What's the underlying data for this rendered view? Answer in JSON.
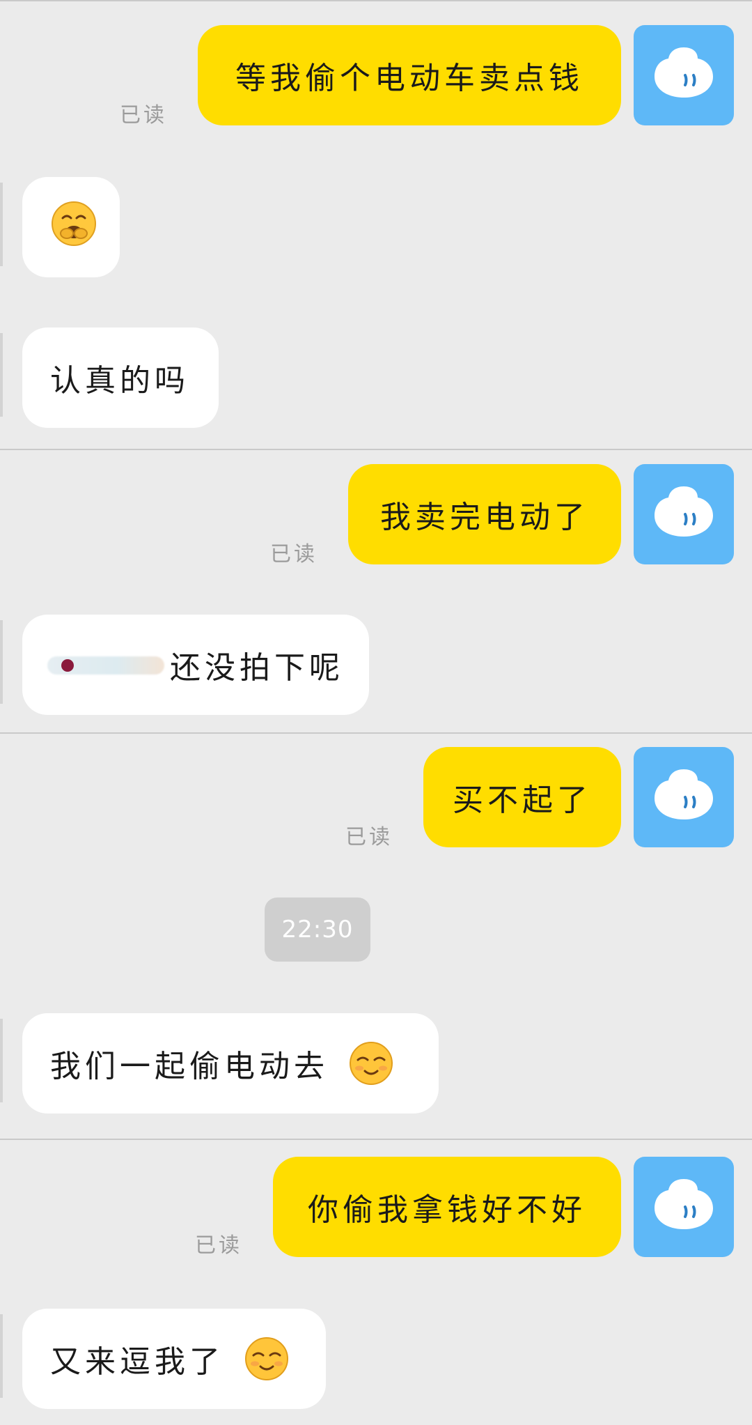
{
  "messages": [
    {
      "side": "out",
      "text": "等我偷个电动车卖点钱",
      "status": "已读"
    },
    {
      "side": "in",
      "emoji": "yawning-face-emoji"
    },
    {
      "side": "in",
      "text": "认真的吗"
    },
    {
      "side": "out",
      "text": "我卖完电动了",
      "status": "已读"
    },
    {
      "side": "in",
      "redacted": true,
      "text": "还没拍下呢"
    },
    {
      "side": "out",
      "text": "买不起了",
      "status": "已读"
    },
    {
      "side": "in",
      "text": "我们一起偷电动去",
      "emoji": "smiling-face-emoji"
    },
    {
      "side": "out",
      "text": "你偷我拿钱好不好",
      "status": "已读"
    },
    {
      "side": "in",
      "text": "又来逗我了",
      "emoji": "smiling-face-emoji"
    }
  ],
  "time_divider": "22:30",
  "colors": {
    "background": "#EBEBEB",
    "outgoing_bubble": "#FFDD00",
    "incoming_bubble": "#FFFFFF",
    "avatar": "#5EB8F7",
    "read_status": "#9B9B9B",
    "time_badge": "#CFCFCF"
  },
  "icons": {
    "avatar": "qq-penguin-default-avatar-icon"
  }
}
